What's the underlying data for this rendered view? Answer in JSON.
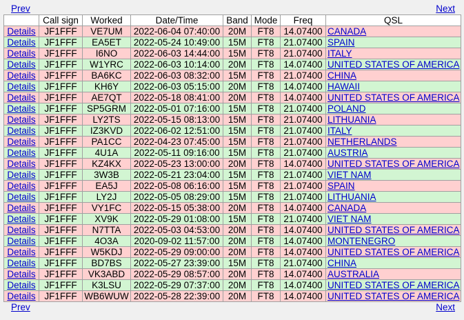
{
  "nav": {
    "prev": "Prev",
    "next": "Next"
  },
  "headers": [
    "",
    "Call sign",
    "Worked",
    "Date/Time",
    "Band",
    "Mode",
    "Freq",
    "QSL"
  ],
  "details_label": "Details",
  "row_colors": {
    "pink": "#ffd0d0",
    "green": "#d2f5d2"
  },
  "rows": [
    {
      "call": "JF1FFF",
      "worked": "VE7UM",
      "datetime": "2022-06-04 07:40:00",
      "band": "20M",
      "mode": "FT8",
      "freq": "14.07400",
      "qsl": "CANADA",
      "color": "pink"
    },
    {
      "call": "JF1FFF",
      "worked": "EA5ET",
      "datetime": "2022-05-24 10:49:00",
      "band": "15M",
      "mode": "FT8",
      "freq": "21.07400",
      "qsl": "SPAIN",
      "color": "green"
    },
    {
      "call": "JF1FFF",
      "worked": "I6NO",
      "datetime": "2022-06-03 14:44:00",
      "band": "15M",
      "mode": "FT8",
      "freq": "21.07400",
      "qsl": "ITALY",
      "color": "pink"
    },
    {
      "call": "JF1FFF",
      "worked": "W1YRC",
      "datetime": "2022-06-03 10:14:00",
      "band": "20M",
      "mode": "FT8",
      "freq": "14.07400",
      "qsl": "UNITED STATES OF AMERICA",
      "color": "green"
    },
    {
      "call": "JF1FFF",
      "worked": "BA6KC",
      "datetime": "2022-06-03 08:32:00",
      "band": "15M",
      "mode": "FT8",
      "freq": "21.07400",
      "qsl": "CHINA",
      "color": "pink"
    },
    {
      "call": "JF1FFF",
      "worked": "KH6Y",
      "datetime": "2022-06-03 05:15:00",
      "band": "20M",
      "mode": "FT8",
      "freq": "14.07400",
      "qsl": "HAWAII",
      "color": "green"
    },
    {
      "call": "JF1FFF",
      "worked": "AE7QT",
      "datetime": "2022-05-18 08:41:00",
      "band": "20M",
      "mode": "FT8",
      "freq": "14.07400",
      "qsl": "UNITED STATES OF AMERICA",
      "color": "pink"
    },
    {
      "call": "JF1FFF",
      "worked": "SP5GRM",
      "datetime": "2022-05-01 07:16:00",
      "band": "15M",
      "mode": "FT8",
      "freq": "21.07400",
      "qsl": "POLAND",
      "color": "green"
    },
    {
      "call": "JF1FFF",
      "worked": "LY2TS",
      "datetime": "2022-05-15 08:13:00",
      "band": "15M",
      "mode": "FT8",
      "freq": "21.07400",
      "qsl": "LITHUANIA",
      "color": "pink"
    },
    {
      "call": "JF1FFF",
      "worked": "IZ3KVD",
      "datetime": "2022-06-02 12:51:00",
      "band": "15M",
      "mode": "FT8",
      "freq": "21.07400",
      "qsl": "ITALY",
      "color": "green"
    },
    {
      "call": "JF1FFF",
      "worked": "PA1CC",
      "datetime": "2022-04-23 07:45:00",
      "band": "15M",
      "mode": "FT8",
      "freq": "21.07400",
      "qsl": "NETHERLANDS",
      "color": "pink"
    },
    {
      "call": "JF1FFF",
      "worked": "4U1A",
      "datetime": "2022-05-11 09:16:00",
      "band": "15M",
      "mode": "FT8",
      "freq": "21.07400",
      "qsl": "AUSTRIA",
      "color": "green"
    },
    {
      "call": "JF1FFF",
      "worked": "KZ4KX",
      "datetime": "2022-05-23 13:00:00",
      "band": "20M",
      "mode": "FT8",
      "freq": "14.07400",
      "qsl": "UNITED STATES OF AMERICA",
      "color": "pink"
    },
    {
      "call": "JF1FFF",
      "worked": "3W3B",
      "datetime": "2022-05-21 23:04:00",
      "band": "15M",
      "mode": "FT8",
      "freq": "21.07400",
      "qsl": "VIET NAM",
      "color": "green"
    },
    {
      "call": "JF1FFF",
      "worked": "EA5J",
      "datetime": "2022-05-08 06:16:00",
      "band": "15M",
      "mode": "FT8",
      "freq": "21.07400",
      "qsl": "SPAIN",
      "color": "pink"
    },
    {
      "call": "JF1FFF",
      "worked": "LY2J",
      "datetime": "2022-05-05 08:29:00",
      "band": "15M",
      "mode": "FT8",
      "freq": "21.07400",
      "qsl": "LITHUANIA",
      "color": "green"
    },
    {
      "call": "JF1FFF",
      "worked": "VY1FC",
      "datetime": "2022-05-15 05:38:00",
      "band": "20M",
      "mode": "FT8",
      "freq": "14.07400",
      "qsl": "CANADA",
      "color": "pink"
    },
    {
      "call": "JF1FFF",
      "worked": "XV9K",
      "datetime": "2022-05-29 01:08:00",
      "band": "15M",
      "mode": "FT8",
      "freq": "21.07400",
      "qsl": "VIET NAM",
      "color": "green"
    },
    {
      "call": "JF1FFF",
      "worked": "N7TTA",
      "datetime": "2022-05-03 04:53:00",
      "band": "20M",
      "mode": "FT8",
      "freq": "14.07400",
      "qsl": "UNITED STATES OF AMERICA",
      "color": "pink"
    },
    {
      "call": "JF1FFF",
      "worked": "4O3A",
      "datetime": "2020-09-02 11:57:00",
      "band": "20M",
      "mode": "FT8",
      "freq": "14.07400",
      "qsl": "MONTENEGRO",
      "color": "green"
    },
    {
      "call": "JF1FFF",
      "worked": "W5KDJ",
      "datetime": "2022-05-29 09:00:00",
      "band": "20M",
      "mode": "FT8",
      "freq": "14.07400",
      "qsl": "UNITED STATES OF AMERICA",
      "color": "pink"
    },
    {
      "call": "JF1FFF",
      "worked": "BD7BS",
      "datetime": "2022-05-27 23:39:00",
      "band": "15M",
      "mode": "FT8",
      "freq": "21.07400",
      "qsl": "CHINA",
      "color": "green"
    },
    {
      "call": "JF1FFF",
      "worked": "VK3ABD",
      "datetime": "2022-05-29 08:57:00",
      "band": "20M",
      "mode": "FT8",
      "freq": "14.07400",
      "qsl": "AUSTRALIA",
      "color": "pink"
    },
    {
      "call": "JF1FFF",
      "worked": "K3LSU",
      "datetime": "2022-05-29 07:37:00",
      "band": "20M",
      "mode": "FT8",
      "freq": "14.07400",
      "qsl": "UNITED STATES OF AMERICA",
      "color": "green"
    },
    {
      "call": "JF1FFF",
      "worked": "WB6WUW",
      "datetime": "2022-05-28 22:39:00",
      "band": "20M",
      "mode": "FT8",
      "freq": "14.07400",
      "qsl": "UNITED STATES OF AMERICA",
      "color": "pink"
    }
  ]
}
